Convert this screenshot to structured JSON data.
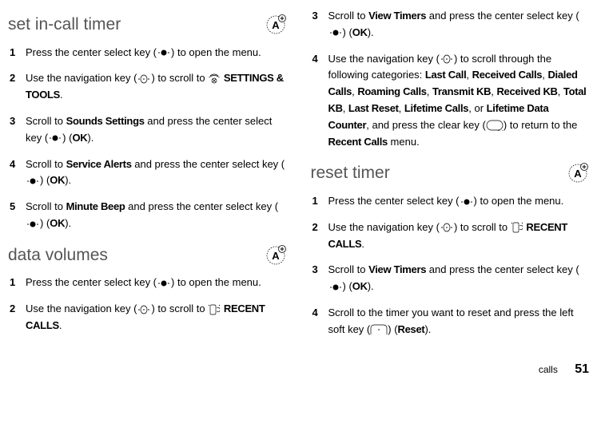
{
  "left": {
    "sec1": {
      "title": "set in-call timer",
      "s1_a": "Press the center select key (",
      "s1_b": ") to open the menu.",
      "s2_a": "Use the navigation key (",
      "s2_b": ") to scroll to ",
      "s2_c": "SETTINGS & TOOLS",
      "s2_d": ".",
      "s3_a": "Scroll to ",
      "s3_b": "Sounds Settings",
      "s3_c": " and press the center select key (",
      "s3_d": ") (",
      "s3_e": "OK",
      "s3_f": ").",
      "s4_a": "Scroll to ",
      "s4_b": "Service Alerts",
      "s4_c": " and press the center select key (",
      "s4_d": ") (",
      "s4_e": "OK",
      "s4_f": ").",
      "s5_a": "Scroll to ",
      "s5_b": "Minute Beep",
      "s5_c": " and press the center select key (",
      "s5_d": ") (",
      "s5_e": "OK",
      "s5_f": ")."
    },
    "sec2": {
      "title": "data volumes",
      "s1_a": "Press the center select key (",
      "s1_b": ") to open the menu.",
      "s2_a": "Use the navigation key (",
      "s2_b": ") to scroll to ",
      "s2_c": "RECENT CALLS",
      "s2_d": "."
    }
  },
  "right": {
    "top": {
      "s3_a": "Scroll to ",
      "s3_b": "View Timers",
      "s3_c": " and press the center select key (",
      "s3_d": ") (",
      "s3_e": "OK",
      "s3_f": ").",
      "s4_a": "Use the navigation key (",
      "s4_b": ") to scroll through the following categories: ",
      "s4_c": "Last Call",
      "s4_sep": ", ",
      "s4_d": "Received Calls",
      "s4_e": "Dialed Calls",
      "s4_f": "Roaming Calls",
      "s4_g": "Transmit KB",
      "s4_h": "Received KB",
      "s4_i": "Total KB",
      "s4_j": "Last Reset",
      "s4_k": "Lifetime Calls",
      "s4_or": ", or ",
      "s4_l": "Lifetime Data Counter",
      "s4_m": ", and press the clear key (",
      "s4_n": ") to return to the ",
      "s4_o": "Recent Calls",
      "s4_p": " menu."
    },
    "sec": {
      "title": "reset timer",
      "s1_a": "Press the center select key (",
      "s1_b": ") to open the menu.",
      "s2_a": "Use the navigation key (",
      "s2_b": ") to scroll to ",
      "s2_c": "RECENT CALLS",
      "s2_d": ".",
      "s3_a": "Scroll to ",
      "s3_b": "View Timers",
      "s3_c": " and press the center select key (",
      "s3_d": ") (",
      "s3_e": "OK",
      "s3_f": ").",
      "s4_a": "Scroll to the timer you want to reset and press the left soft key (",
      "s4_b": ") (",
      "s4_c": "Reset",
      "s4_d": ")."
    }
  },
  "footer": {
    "label": "calls",
    "page": "51"
  },
  "clr": "CLR"
}
